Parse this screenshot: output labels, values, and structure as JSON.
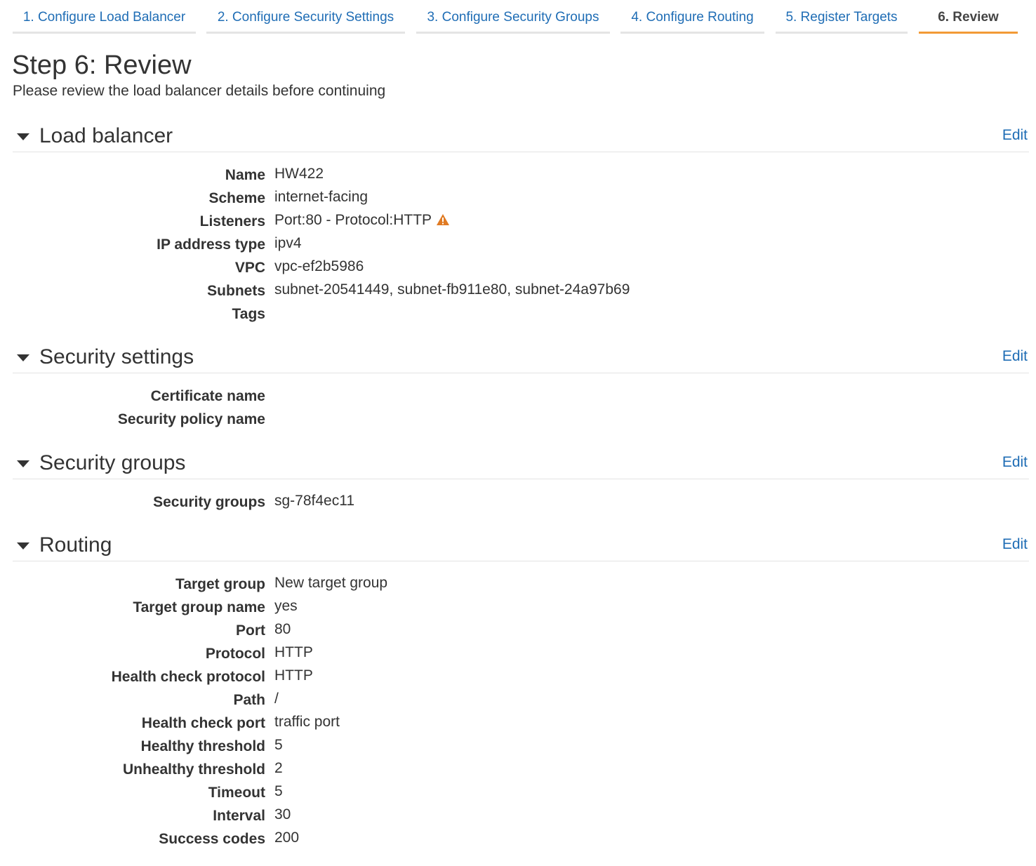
{
  "wizard": {
    "tabs": [
      {
        "label": "1. Configure Load Balancer"
      },
      {
        "label": "2. Configure Security Settings"
      },
      {
        "label": "3. Configure Security Groups"
      },
      {
        "label": "4. Configure Routing"
      },
      {
        "label": "5. Register Targets"
      },
      {
        "label": "6. Review",
        "active": true
      }
    ],
    "accent_color": "#f29a36",
    "link_color": "#1f6db5"
  },
  "page": {
    "title": "Step 6: Review",
    "subtitle": "Please review the load balancer details before continuing"
  },
  "sections": {
    "load_balancer": {
      "title": "Load balancer",
      "edit_label": "Edit",
      "fields": {
        "name": {
          "label": "Name",
          "value": "HW422"
        },
        "scheme": {
          "label": "Scheme",
          "value": "internet-facing"
        },
        "listeners": {
          "label": "Listeners",
          "value": "Port:80 - Protocol:HTTP",
          "icon": "warning-icon"
        },
        "ip_address_type": {
          "label": "IP address type",
          "value": "ipv4"
        },
        "vpc": {
          "label": "VPC",
          "value": "vpc-ef2b5986"
        },
        "subnets": {
          "label": "Subnets",
          "value": "subnet-20541449, subnet-fb911e80, subnet-24a97b69"
        },
        "tags": {
          "label": "Tags",
          "value": ""
        }
      }
    },
    "security_settings": {
      "title": "Security settings",
      "edit_label": "Edit",
      "fields": {
        "certificate_name": {
          "label": "Certificate name",
          "value": ""
        },
        "security_policy_name": {
          "label": "Security policy name",
          "value": ""
        }
      }
    },
    "security_groups": {
      "title": "Security groups",
      "edit_label": "Edit",
      "fields": {
        "security_groups": {
          "label": "Security groups",
          "value": "sg-78f4ec11"
        }
      }
    },
    "routing": {
      "title": "Routing",
      "edit_label": "Edit",
      "fields": {
        "target_group": {
          "label": "Target group",
          "value": "New target group"
        },
        "target_group_name": {
          "label": "Target group name",
          "value": "yes"
        },
        "port": {
          "label": "Port",
          "value": "80"
        },
        "protocol": {
          "label": "Protocol",
          "value": "HTTP"
        },
        "health_check_protocol": {
          "label": "Health check protocol",
          "value": "HTTP"
        },
        "path": {
          "label": "Path",
          "value": "/"
        },
        "health_check_port": {
          "label": "Health check port",
          "value": "traffic port"
        },
        "healthy_threshold": {
          "label": "Healthy threshold",
          "value": "5"
        },
        "unhealthy_threshold": {
          "label": "Unhealthy threshold",
          "value": "2"
        },
        "timeout": {
          "label": "Timeout",
          "value": "5"
        },
        "interval": {
          "label": "Interval",
          "value": "30"
        },
        "success_codes": {
          "label": "Success codes",
          "value": "200"
        }
      }
    }
  }
}
